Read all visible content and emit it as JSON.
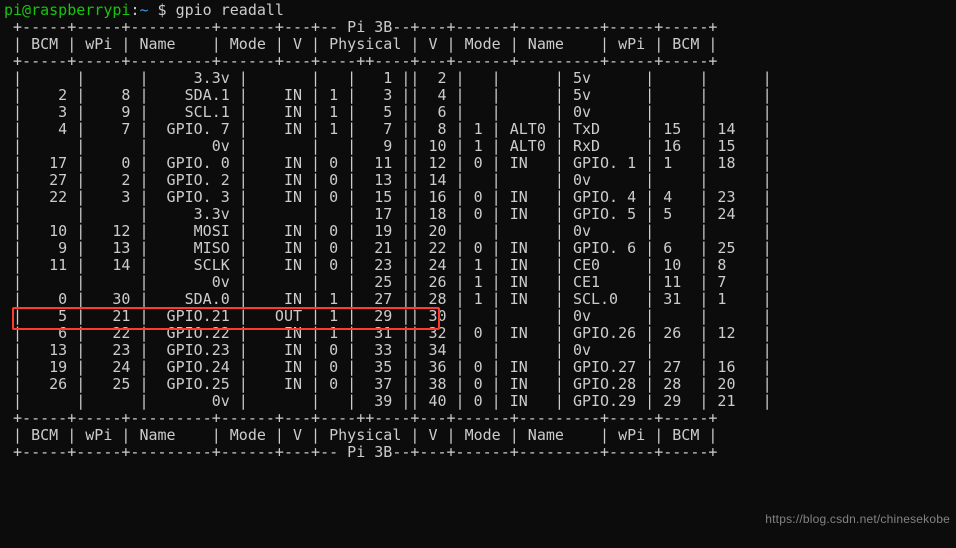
{
  "prompt": {
    "user": "pi",
    "host": "raspberrypi",
    "path": "~",
    "cmd": "gpio readall"
  },
  "table": {
    "title": "Pi 3B",
    "headers": [
      "BCM",
      "wPi",
      "Name",
      "Mode",
      "V",
      "Physical",
      "V",
      "Mode",
      "Name",
      "wPi",
      "BCM"
    ],
    "rows": [
      {
        "lb": "",
        "lw": "",
        "ln": "3.3v",
        "lm": "",
        "lv": "",
        "p1": "1",
        "p2": "2",
        "rv": "",
        "rm": "",
        "rn": "5v",
        "rw": "",
        "rb": ""
      },
      {
        "lb": "2",
        "lw": "8",
        "ln": "SDA.1",
        "lm": "IN",
        "lv": "1",
        "p1": "3",
        "p2": "4",
        "rv": "",
        "rm": "",
        "rn": "5v",
        "rw": "",
        "rb": ""
      },
      {
        "lb": "3",
        "lw": "9",
        "ln": "SCL.1",
        "lm": "IN",
        "lv": "1",
        "p1": "5",
        "p2": "6",
        "rv": "",
        "rm": "",
        "rn": "0v",
        "rw": "",
        "rb": ""
      },
      {
        "lb": "4",
        "lw": "7",
        "ln": "GPIO. 7",
        "lm": "IN",
        "lv": "1",
        "p1": "7",
        "p2": "8",
        "rv": "1",
        "rm": "ALT0",
        "rn": "TxD",
        "rw": "15",
        "rb": "14"
      },
      {
        "lb": "",
        "lw": "",
        "ln": "0v",
        "lm": "",
        "lv": "",
        "p1": "9",
        "p2": "10",
        "rv": "1",
        "rm": "ALT0",
        "rn": "RxD",
        "rw": "16",
        "rb": "15"
      },
      {
        "lb": "17",
        "lw": "0",
        "ln": "GPIO. 0",
        "lm": "IN",
        "lv": "0",
        "p1": "11",
        "p2": "12",
        "rv": "0",
        "rm": "IN",
        "rn": "GPIO. 1",
        "rw": "1",
        "rb": "18"
      },
      {
        "lb": "27",
        "lw": "2",
        "ln": "GPIO. 2",
        "lm": "IN",
        "lv": "0",
        "p1": "13",
        "p2": "14",
        "rv": "",
        "rm": "",
        "rn": "0v",
        "rw": "",
        "rb": ""
      },
      {
        "lb": "22",
        "lw": "3",
        "ln": "GPIO. 3",
        "lm": "IN",
        "lv": "0",
        "p1": "15",
        "p2": "16",
        "rv": "0",
        "rm": "IN",
        "rn": "GPIO. 4",
        "rw": "4",
        "rb": "23"
      },
      {
        "lb": "",
        "lw": "",
        "ln": "3.3v",
        "lm": "",
        "lv": "",
        "p1": "17",
        "p2": "18",
        "rv": "0",
        "rm": "IN",
        "rn": "GPIO. 5",
        "rw": "5",
        "rb": "24"
      },
      {
        "lb": "10",
        "lw": "12",
        "ln": "MOSI",
        "lm": "IN",
        "lv": "0",
        "p1": "19",
        "p2": "20",
        "rv": "",
        "rm": "",
        "rn": "0v",
        "rw": "",
        "rb": ""
      },
      {
        "lb": "9",
        "lw": "13",
        "ln": "MISO",
        "lm": "IN",
        "lv": "0",
        "p1": "21",
        "p2": "22",
        "rv": "0",
        "rm": "IN",
        "rn": "GPIO. 6",
        "rw": "6",
        "rb": "25"
      },
      {
        "lb": "11",
        "lw": "14",
        "ln": "SCLK",
        "lm": "IN",
        "lv": "0",
        "p1": "23",
        "p2": "24",
        "rv": "1",
        "rm": "IN",
        "rn": "CE0",
        "rw": "10",
        "rb": "8"
      },
      {
        "lb": "",
        "lw": "",
        "ln": "0v",
        "lm": "",
        "lv": "",
        "p1": "25",
        "p2": "26",
        "rv": "1",
        "rm": "IN",
        "rn": "CE1",
        "rw": "11",
        "rb": "7"
      },
      {
        "lb": "0",
        "lw": "30",
        "ln": "SDA.0",
        "lm": "IN",
        "lv": "1",
        "p1": "27",
        "p2": "28",
        "rv": "1",
        "rm": "IN",
        "rn": "SCL.0",
        "rw": "31",
        "rb": "1"
      },
      {
        "lb": "5",
        "lw": "21",
        "ln": "GPIO.21",
        "lm": "OUT",
        "lv": "1",
        "p1": "29",
        "p2": "30",
        "rv": "",
        "rm": "",
        "rn": "0v",
        "rw": "",
        "rb": ""
      },
      {
        "lb": "6",
        "lw": "22",
        "ln": "GPIO.22",
        "lm": "IN",
        "lv": "1",
        "p1": "31",
        "p2": "32",
        "rv": "0",
        "rm": "IN",
        "rn": "GPIO.26",
        "rw": "26",
        "rb": "12"
      },
      {
        "lb": "13",
        "lw": "23",
        "ln": "GPIO.23",
        "lm": "IN",
        "lv": "0",
        "p1": "33",
        "p2": "34",
        "rv": "",
        "rm": "",
        "rn": "0v",
        "rw": "",
        "rb": ""
      },
      {
        "lb": "19",
        "lw": "24",
        "ln": "GPIO.24",
        "lm": "IN",
        "lv": "0",
        "p1": "35",
        "p2": "36",
        "rv": "0",
        "rm": "IN",
        "rn": "GPIO.27",
        "rw": "27",
        "rb": "16"
      },
      {
        "lb": "26",
        "lw": "25",
        "ln": "GPIO.25",
        "lm": "IN",
        "lv": "0",
        "p1": "37",
        "p2": "38",
        "rv": "0",
        "rm": "IN",
        "rn": "GPIO.28",
        "rw": "28",
        "rb": "20"
      },
      {
        "lb": "",
        "lw": "",
        "ln": "0v",
        "lm": "",
        "lv": "",
        "p1": "39",
        "p2": "40",
        "rv": "0",
        "rm": "IN",
        "rn": "GPIO.29",
        "rw": "29",
        "rb": "21"
      }
    ]
  },
  "watermark": "https://blog.csdn.net/chinesekobe",
  "highlight": {
    "row_index": 14
  }
}
